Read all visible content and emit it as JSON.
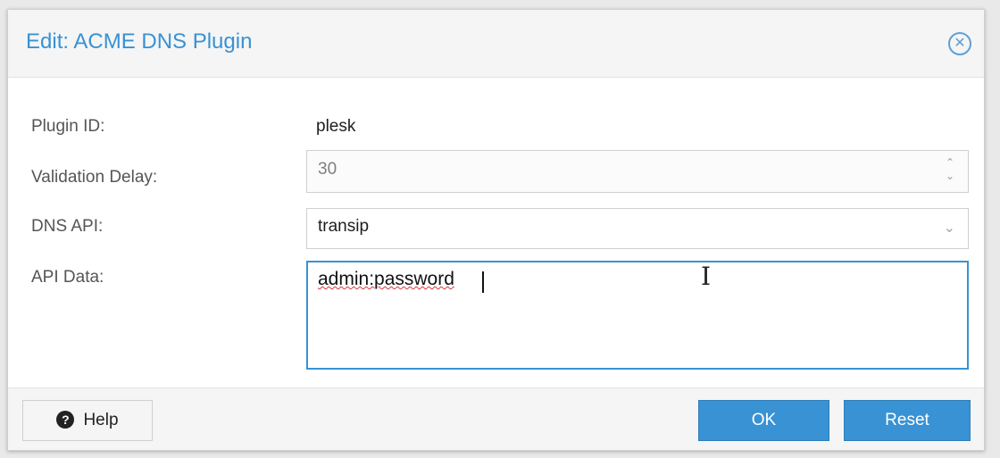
{
  "dialog": {
    "title": "Edit: ACME DNS Plugin",
    "close_icon": "close-circle-icon"
  },
  "form": {
    "plugin_id_label": "Plugin ID:",
    "plugin_id_value": "plesk",
    "validation_delay_label": "Validation Delay:",
    "validation_delay_value": "30",
    "dns_api_label": "DNS API:",
    "dns_api_value": "transip",
    "api_data_label": "API Data:",
    "api_data_value": "admin:password"
  },
  "footer": {
    "help_label": "Help",
    "ok_label": "OK",
    "reset_label": "Reset"
  },
  "colors": {
    "accent": "#3892d4",
    "muted_text": "#555555"
  }
}
